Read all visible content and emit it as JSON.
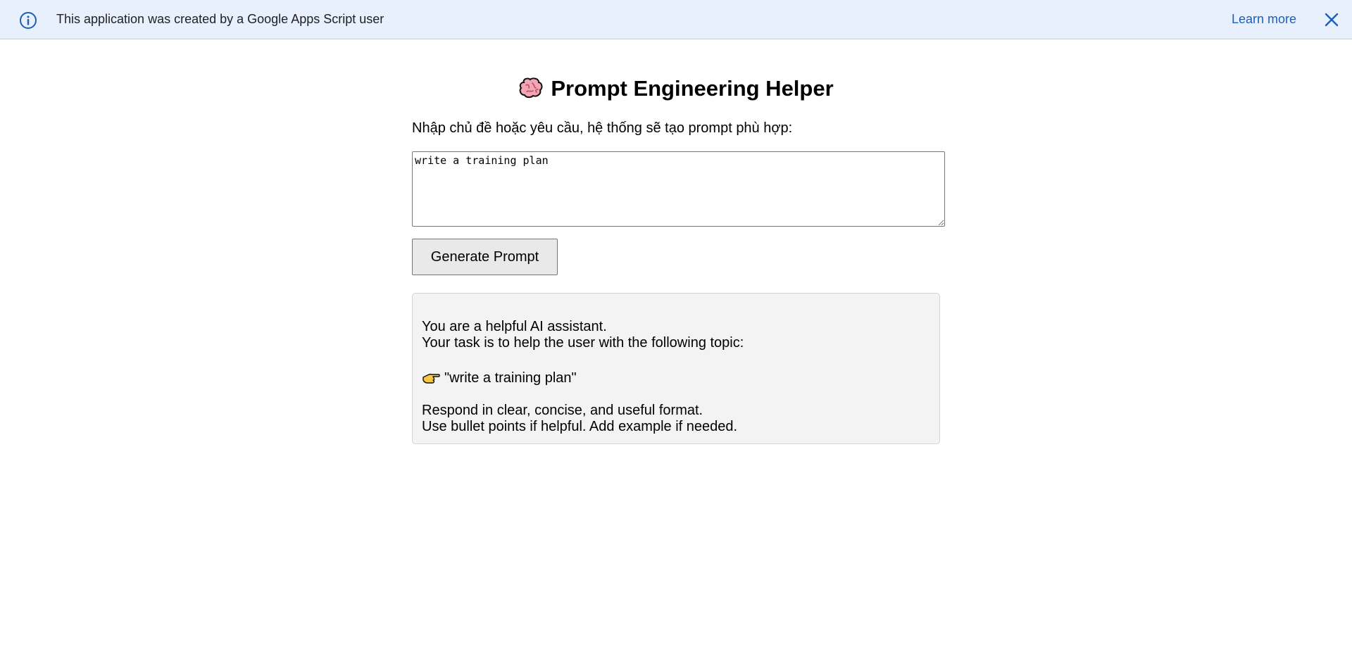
{
  "banner": {
    "info_icon": "info-icon",
    "text": "This application was created by a Google Apps Script user",
    "learn_more": "Learn more",
    "close_icon": "close-icon"
  },
  "app": {
    "title_icon": "brain-icon",
    "title": "Prompt Engineering Helper",
    "instruction": "Nhập chủ đề hoặc yêu cầu, hệ thống sẽ tạo prompt phù hợp:",
    "input_value": "write a training plan",
    "generate_label": "Generate Prompt"
  },
  "result": {
    "line1": "You are a helpful AI assistant.",
    "line2": "Your task is to help the user with the following topic:",
    "topic_icon": "pointing-hand-icon",
    "topic": "\"write a training plan\"",
    "line3": "Respond in clear, concise, and useful format.",
    "line4": "Use bullet points if helpful. Add example if needed."
  },
  "colors": {
    "banner_bg": "#e8f0fe",
    "link": "#1a5fb4",
    "result_bg": "#f3f3f3"
  }
}
